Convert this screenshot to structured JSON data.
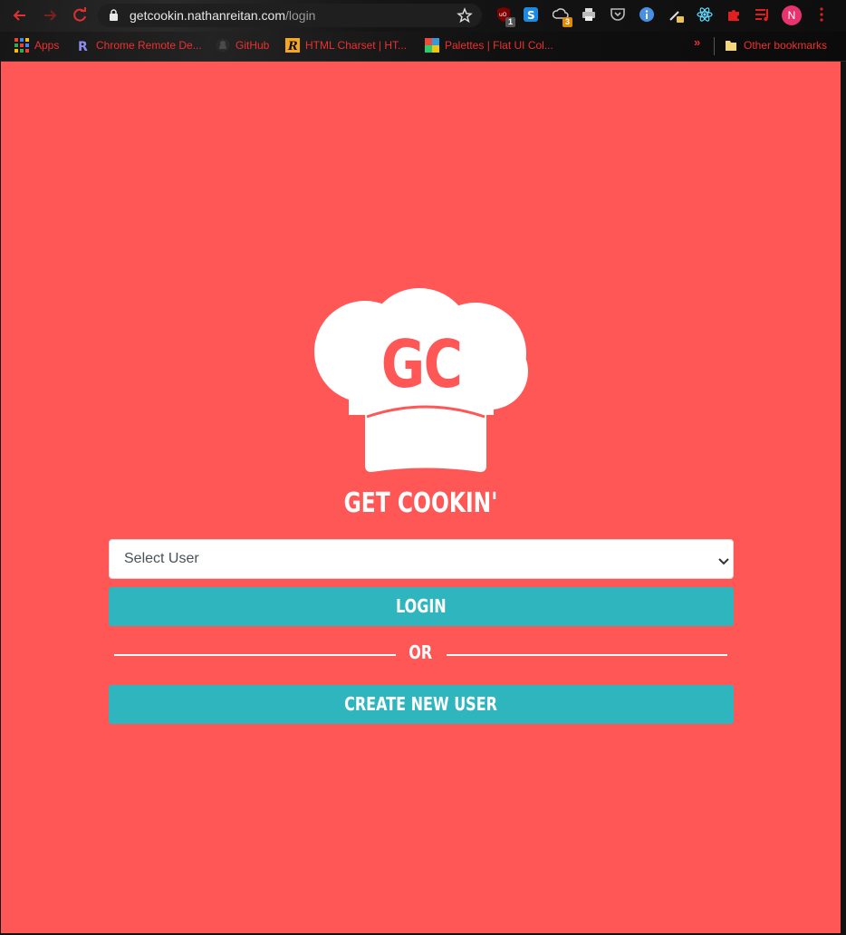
{
  "browser": {
    "url_host": "getcookin.nathanreitan.com",
    "url_path": "/login",
    "extensions": [
      {
        "name": "ublock-icon",
        "badge": "1"
      },
      {
        "name": "s-extension-icon",
        "badge": ""
      },
      {
        "name": "cloud-extension-icon",
        "badge": "3"
      },
      {
        "name": "print-icon",
        "badge": ""
      },
      {
        "name": "pocket-icon",
        "badge": ""
      },
      {
        "name": "info-icon",
        "badge": ""
      },
      {
        "name": "eyedropper-icon",
        "badge": ""
      },
      {
        "name": "react-devtools-icon",
        "badge": ""
      },
      {
        "name": "puzzle-icon",
        "badge": ""
      },
      {
        "name": "media-queue-icon",
        "badge": ""
      }
    ],
    "profile_initial": "N",
    "bookmarks": [
      {
        "label": "Apps",
        "icon": "apps-grid-icon"
      },
      {
        "label": "Chrome Remote De...",
        "icon": "r-logo-icon"
      },
      {
        "label": "GitHub",
        "icon": "github-icon"
      },
      {
        "label": "HTML Charset | HT...",
        "icon": "r-italic-icon"
      },
      {
        "label": "Palettes | Flat UI Col...",
        "icon": "palette-icon"
      }
    ],
    "overflow_label": "»",
    "other_bookmarks": "Other bookmarks"
  },
  "app": {
    "logo_text": "GC",
    "title": "GET COOKIN'",
    "select_placeholder": "Select User",
    "login_label": "LOGIN",
    "or_label": "OR",
    "create_label": "CREATE NEW USER"
  },
  "colors": {
    "background": "#ff5656",
    "button": "#2fb5bd",
    "text": "#ffffff"
  }
}
